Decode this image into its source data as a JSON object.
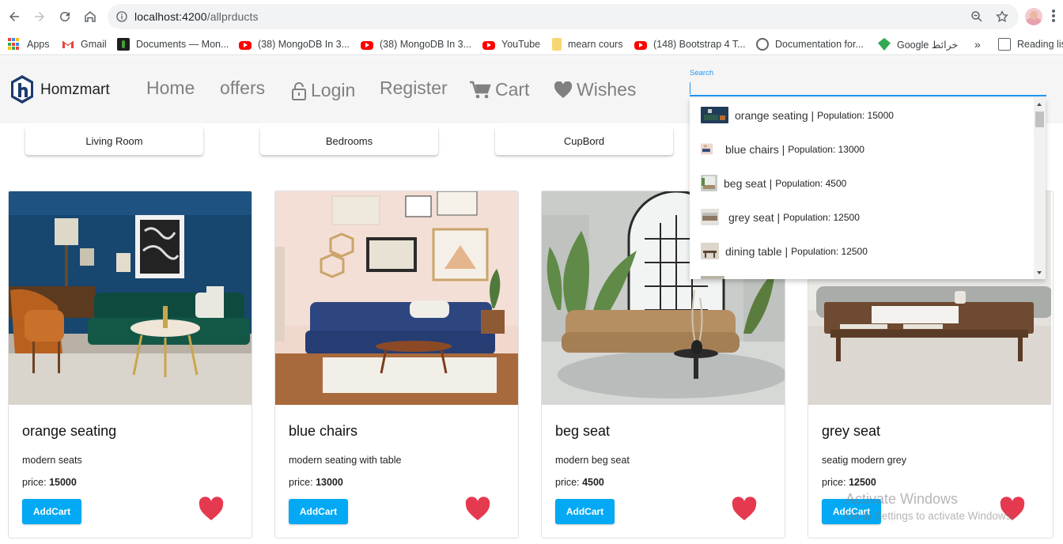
{
  "browser": {
    "url_host": "localhost:4200",
    "url_path": "/allprducts",
    "bookmarks": [
      {
        "label": "Apps",
        "icon": "apps-grid-icon"
      },
      {
        "label": "Gmail",
        "icon": "gmail-icon"
      },
      {
        "label": "Documents — Mon...",
        "icon": "mongodb-docs-icon"
      },
      {
        "label": "(38) MongoDB In 3...",
        "icon": "youtube-icon"
      },
      {
        "label": "(38) MongoDB In 3...",
        "icon": "youtube-icon"
      },
      {
        "label": "YouTube",
        "icon": "youtube-icon"
      },
      {
        "label": "mearn cours",
        "icon": "folder-icon"
      },
      {
        "label": "(148) Bootstrap 4 T...",
        "icon": "youtube-icon"
      },
      {
        "label": "Documentation for...",
        "icon": "globe-icon"
      },
      {
        "label": "Google خرائط",
        "icon": "google-maps-icon"
      },
      {
        "label": "»",
        "icon": ""
      },
      {
        "label": "Reading lis",
        "icon": "reading-list-icon"
      }
    ]
  },
  "navbar": {
    "brand": "Homzmart",
    "links": {
      "home": "Home",
      "offers": "offers",
      "login": "Login",
      "register": "Register",
      "cart": "Cart",
      "wishes": "Wishes"
    },
    "search_label": "Search",
    "search_value": ""
  },
  "search_results": [
    {
      "name": "orange seating",
      "sep": "|",
      "population": "Population: 15000"
    },
    {
      "name": "blue chairs",
      "sep": "|",
      "population": "Population: 13000"
    },
    {
      "name": "beg seat",
      "sep": "|",
      "population": "Population: 4500"
    },
    {
      "name": "grey seat",
      "sep": "|",
      "population": "Population: 12500"
    },
    {
      "name": "dining table",
      "sep": "|",
      "population": "Population: 12500"
    }
  ],
  "categories": [
    "Living Room",
    "Bedrooms",
    "CupBord"
  ],
  "products": [
    {
      "title": "orange seating",
      "desc": "modern seats",
      "price_label": "price:",
      "price": "15000",
      "button": "AddCart"
    },
    {
      "title": "blue chairs",
      "desc": "modern seating with table",
      "price_label": "price:",
      "price": "13000",
      "button": "AddCart"
    },
    {
      "title": "beg seat",
      "desc": "modern beg seat",
      "price_label": "price:",
      "price": "4500",
      "button": "AddCart"
    },
    {
      "title": "grey seat",
      "desc": "seatig modern grey",
      "price_label": "price:",
      "price": "12500",
      "button": "AddCart"
    }
  ],
  "watermark": {
    "line1": "Activate Windows",
    "line2": "Go to Settings to activate Windows."
  },
  "colors": {
    "accent_blue": "#03a9f4",
    "search_blue": "#2196f3",
    "heart_red": "#e53950",
    "nav_gray": "#808080"
  }
}
